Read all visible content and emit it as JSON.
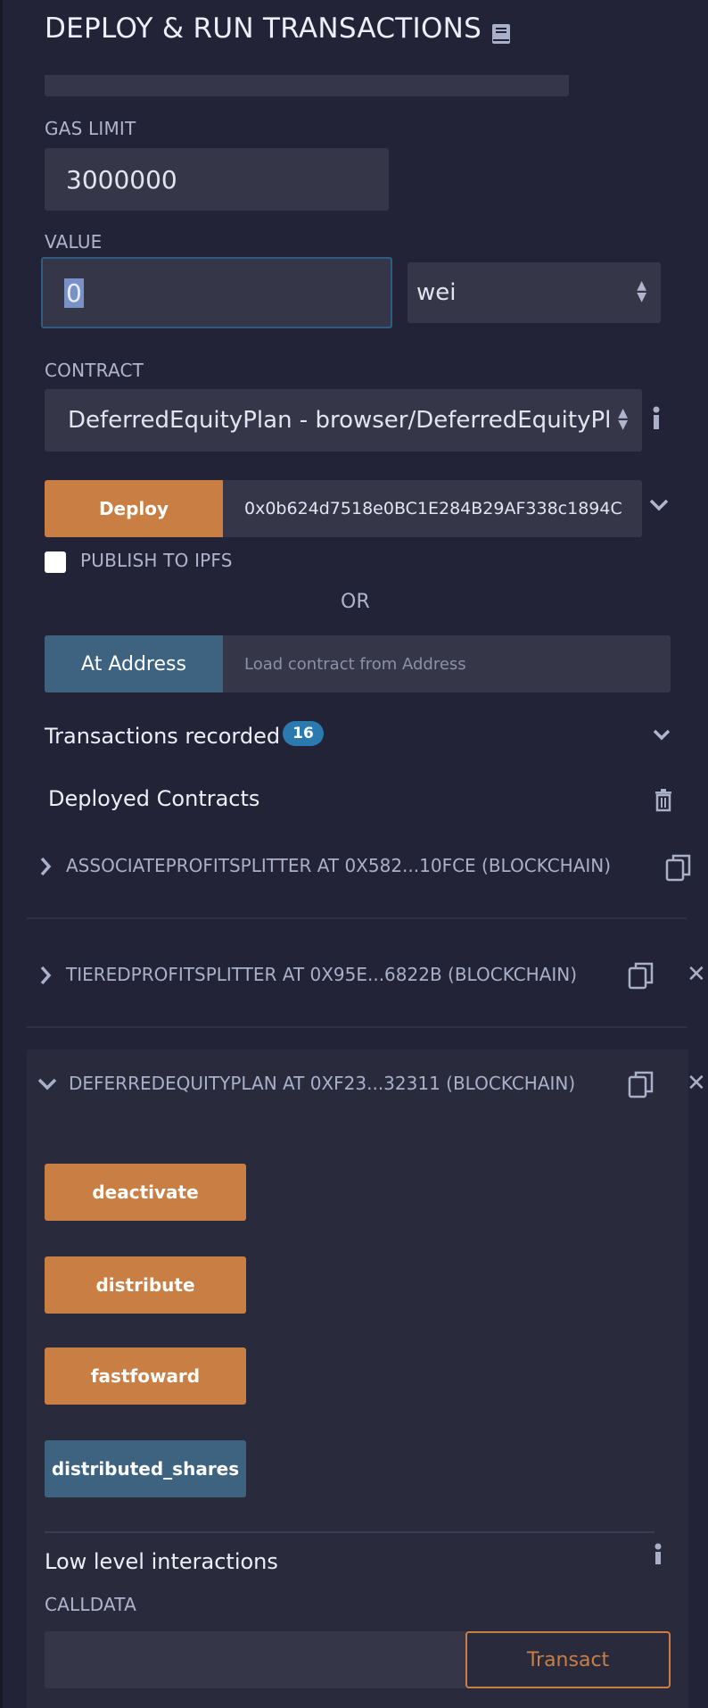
{
  "header": {
    "title": "DEPLOY & RUN TRANSACTIONS",
    "icon": "book-icon"
  },
  "gas_limit": {
    "label": "GAS LIMIT",
    "value": "3000000"
  },
  "value": {
    "label": "VALUE",
    "amount": "0",
    "unit": "wei"
  },
  "contract": {
    "label": "CONTRACT",
    "selected": "DeferredEquityPlan - browser/DeferredEquityPlan.sol"
  },
  "deploy": {
    "button": "Deploy",
    "args": "0x0b624d7518e0BC1E284B29AF338c1894C"
  },
  "publish": {
    "label": "PUBLISH TO IPFS",
    "checked": false
  },
  "or_text": "OR",
  "at_address": {
    "button": "At Address",
    "placeholder": "Load contract from Address"
  },
  "transactions": {
    "label": "Transactions recorded",
    "count": "16"
  },
  "deployed": {
    "label": "Deployed Contracts",
    "contracts": [
      {
        "title": "ASSOCIATEPROFITSPLITTER AT 0X582...10FCE (BLOCKCHAIN)",
        "expanded": false
      },
      {
        "title": "TIEREDPROFITSPLITTER AT 0X95E...6822B (BLOCKCHAIN)",
        "expanded": false
      },
      {
        "title": "DEFERREDEQUITYPLAN AT 0XF23...32311 (BLOCKCHAIN)",
        "expanded": true
      }
    ],
    "functions": [
      "deactivate",
      "distribute",
      "fastfoward",
      "distributed_shares"
    ]
  },
  "low_level": {
    "label": "Low level interactions",
    "calldata_label": "CALLDATA",
    "transact": "Transact"
  },
  "colors": {
    "background": "#222336",
    "orange": "#c97e44",
    "blue": "#3d6380",
    "badge": "#2a7ab0"
  }
}
